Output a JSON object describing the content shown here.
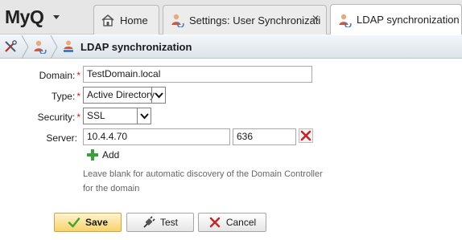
{
  "app": {
    "logo": "MyQ"
  },
  "tabs": [
    {
      "label": "Home",
      "icon": "home-icon"
    },
    {
      "label": "Settings: User Synchronizati",
      "icon": "user-sync-icon"
    },
    {
      "label": "LDAP synchronization",
      "icon": "user-sync-icon",
      "active": true
    }
  ],
  "breadcrumb": {
    "title": "LDAP synchronization"
  },
  "form": {
    "domain": {
      "label": "Domain:",
      "value": "TestDomain.local",
      "required": true
    },
    "type": {
      "label": "Type:",
      "value": "Active Directory",
      "required": true
    },
    "security": {
      "label": "Security:",
      "value": "SSL",
      "required": true
    },
    "server": {
      "label": "Server:",
      "host": "10.4.4.70",
      "port": "636"
    },
    "add_label": "Add",
    "hint": "Leave blank for automatic discovery of the Domain Controller for the domain"
  },
  "buttons": {
    "save": "Save",
    "test": "Test",
    "cancel": "Cancel"
  },
  "colors": {
    "required": "#d11a1a",
    "add_green": "#3aa13a",
    "delete_red": "#c0282a",
    "save_check": "#4aa52e"
  }
}
